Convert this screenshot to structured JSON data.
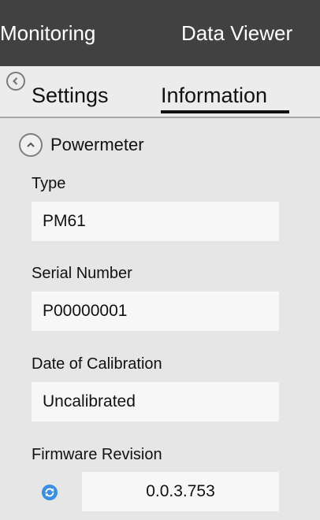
{
  "topbar": {
    "tabs": [
      "Monitoring",
      "Data Viewer"
    ]
  },
  "subtabs": {
    "items": [
      "Settings",
      "Information"
    ],
    "active": "Information"
  },
  "section": {
    "title": "Powermeter",
    "expanded": true
  },
  "fields": {
    "type": {
      "label": "Type",
      "value": "PM61"
    },
    "serial": {
      "label": "Serial Number",
      "value": "P00000001"
    },
    "calibration": {
      "label": "Date of Calibration",
      "value": "Uncalibrated"
    },
    "firmware": {
      "label": "Firmware Revision",
      "value": "0.0.3.753"
    }
  },
  "icons": {
    "back": "chevron-left-icon",
    "collapse": "chevron-up-icon",
    "refresh": "refresh-icon"
  },
  "colors": {
    "topbar": "#414141",
    "accent": "#3a8fe0"
  }
}
